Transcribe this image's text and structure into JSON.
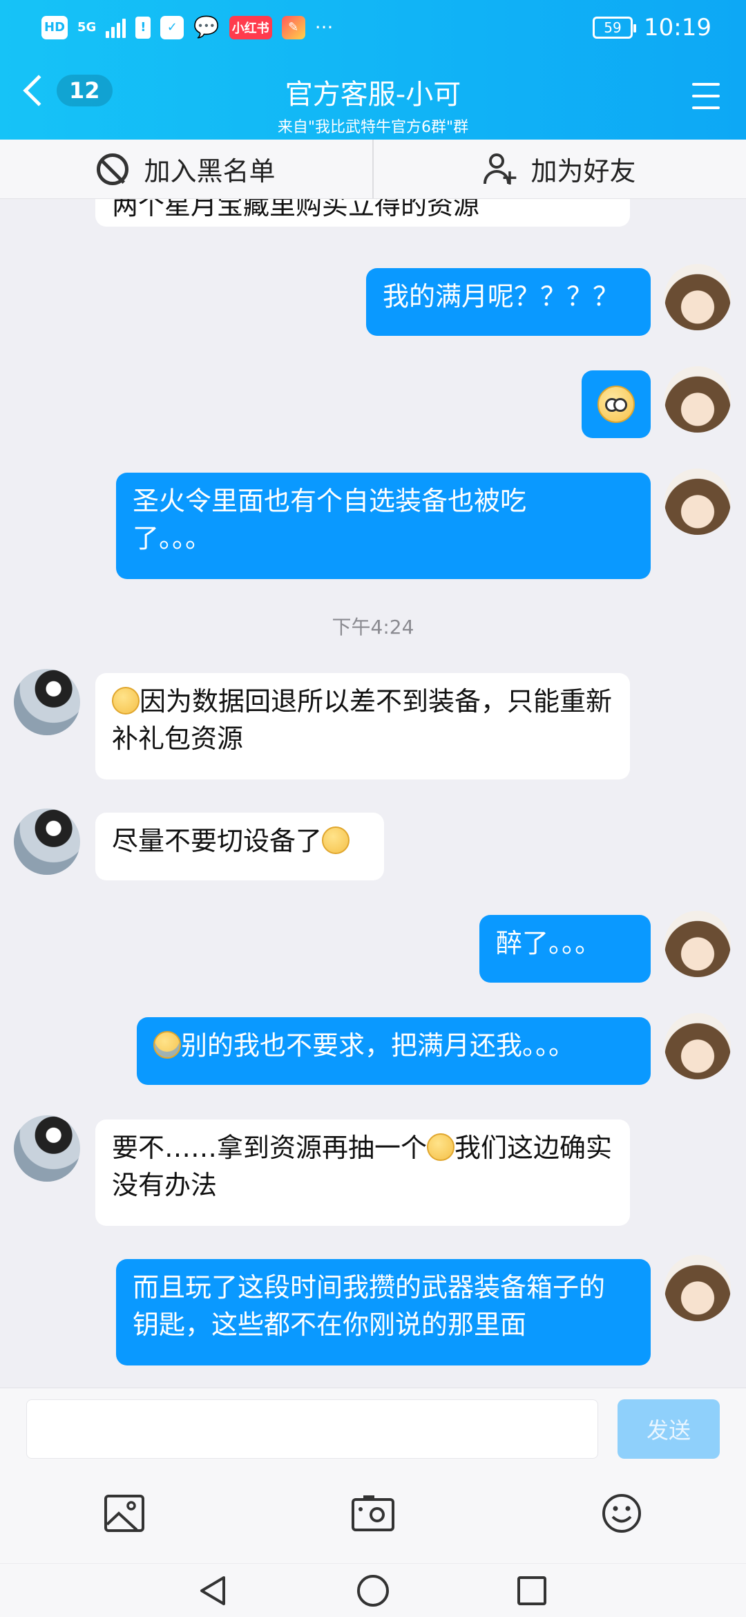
{
  "status_bar": {
    "left_badges": [
      "HD",
      "5G",
      "小红书"
    ],
    "more": "···",
    "battery": "59",
    "time": "10:19"
  },
  "header": {
    "back_badge": "12",
    "title": "官方客服-小可",
    "subtitle": "来自\"我比武特牛官方6群\"群"
  },
  "actions": {
    "blacklist": "加入黑名单",
    "add_friend": "加为好友"
  },
  "messages": [
    {
      "from": "agent",
      "text": "两个星月宝藏里购买立得的资源"
    },
    {
      "from": "user",
      "text": "我的满月呢？？？？"
    },
    {
      "from": "user",
      "emoji": "stunned-emoji"
    },
    {
      "from": "user",
      "text": "圣火令里面也有个自选装备也被吃了。。。"
    },
    {
      "type": "time",
      "text": "下午4:24"
    },
    {
      "from": "agent",
      "text": "因为数据回退所以差不到装备，只能重新补礼包资源"
    },
    {
      "from": "agent",
      "text": "尽量不要切设备了"
    },
    {
      "from": "user",
      "text": "醉了。。。"
    },
    {
      "from": "user",
      "text": "别的我也不要求，把满月还我。。。"
    },
    {
      "from": "agent",
      "text_a": "要不……拿到资源再抽一个",
      "text_b": "我们这边确实没有办法"
    },
    {
      "from": "user",
      "text": "而且玩了这段时间我攒的武器装备箱子的钥匙，这些都不在你刚说的那里面"
    }
  ],
  "input": {
    "placeholder": "",
    "send_label": "发送"
  },
  "colors": {
    "header": "#0da8f5",
    "outgoing_bubble": "#0a99ff",
    "incoming_bubble": "#ffffff",
    "background": "#efeff4"
  }
}
